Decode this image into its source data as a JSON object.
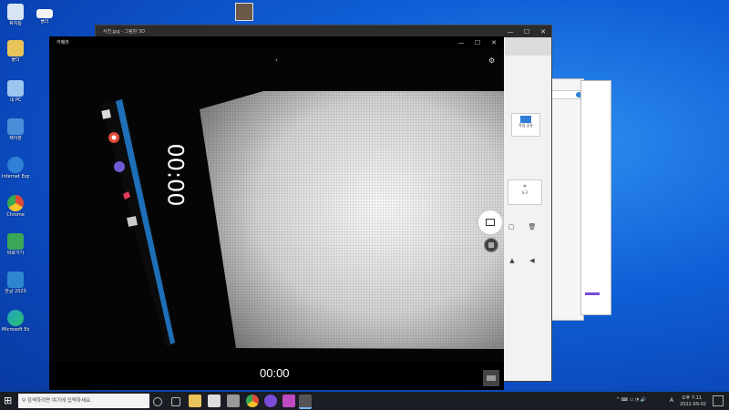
{
  "desktop": {
    "icons": [
      {
        "name": "recycle-bin",
        "label": "휴지통",
        "color": "#d7e4f3"
      },
      {
        "name": "folder",
        "label": "폴더",
        "color": "#e8c35a"
      },
      {
        "name": "this-pc",
        "label": "내 PC",
        "color": "#9cc6ef"
      },
      {
        "name": "control-panel",
        "label": "제어판",
        "color": "#4b8ed8"
      },
      {
        "name": "internet-explorer",
        "label": "Internet Explorer",
        "color": "#2f80d6"
      },
      {
        "name": "chrome",
        "label": "Chrome",
        "color": "#e04a3a"
      },
      {
        "name": "app-green",
        "label": "바로가기",
        "color": "#3aa657"
      },
      {
        "name": "app-korean",
        "label": "한글 2020",
        "color": "#2e86d0"
      },
      {
        "name": "edge",
        "label": "Microsoft Edge",
        "color": "#1fa0c6"
      }
    ],
    "top_icon": {
      "label": "폴더"
    }
  },
  "paint3d": {
    "title": "사진.jpg - 그림판 3D",
    "buttons": [
      "작업 공유",
      "도구"
    ],
    "ctrl": [
      "—",
      "☐",
      "✕"
    ]
  },
  "camera": {
    "title": "카메라",
    "timer": "00:00",
    "video_timer_overlay": "00:00",
    "ctrl": [
      "—",
      "☐",
      "✕"
    ],
    "settings_icon": "⚙",
    "flip_icon": "›"
  },
  "taskbar": {
    "search_placeholder": "검색하려면 여기에 입력하세요.",
    "time": "오후 7:11",
    "date": "2022-09-02",
    "lang": "A",
    "start_icon": "⊞"
  },
  "colors": {
    "accent": "#0078d7",
    "taskbar": "#1a1d24",
    "camera_bg": "#000000"
  }
}
